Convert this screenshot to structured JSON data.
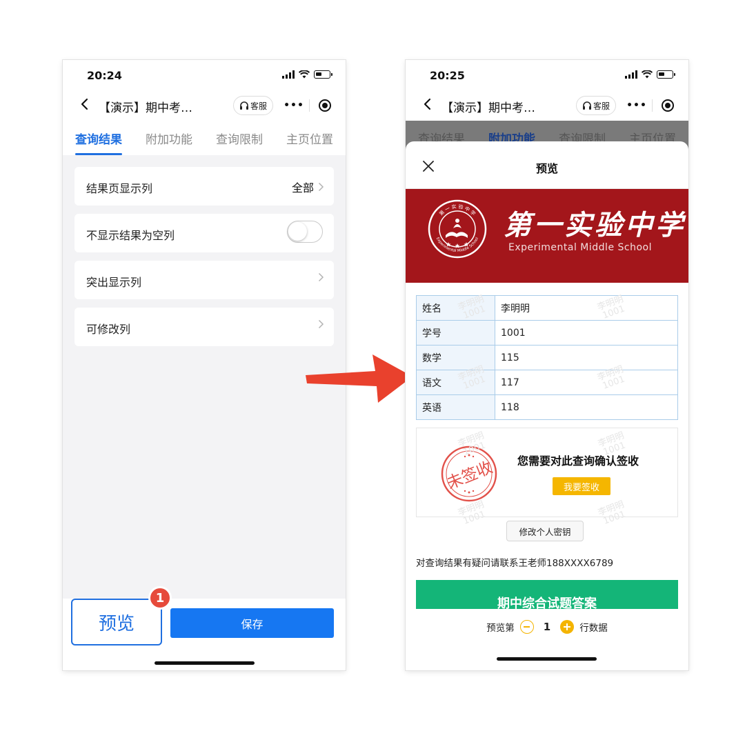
{
  "left_phone": {
    "status": {
      "time": "20:24"
    },
    "nav": {
      "title": "【演示】期中考…",
      "kefu_label": "客服",
      "more_label": "•••"
    },
    "tabs": [
      "查询结果",
      "附加功能",
      "查询限制",
      "主页位置"
    ],
    "settings": [
      {
        "label": "结果页显示列",
        "value": "全部"
      },
      {
        "label": "不显示结果为空列"
      },
      {
        "label": "突出显示列"
      },
      {
        "label": "可修改列"
      }
    ],
    "bottom": {
      "preview_label": "预览",
      "badge": "1",
      "save_label": "保存"
    }
  },
  "right_phone": {
    "status": {
      "time": "20:25"
    },
    "nav": {
      "title": "【演示】期中考…",
      "kefu_label": "客服",
      "more_label": "•••"
    },
    "tabs": [
      "查询结果",
      "附加功能",
      "查询限制",
      "主页位置"
    ],
    "sheet": {
      "title": "预览",
      "school_cn": "第一实验中学",
      "school_en": "Experimental Middle School",
      "seal_top_text": "第 一 实 验 中 学",
      "seal_bottom_text": "Experimental Middle School",
      "rows": [
        {
          "k": "姓名",
          "v": "李明明"
        },
        {
          "k": "学号",
          "v": "1001"
        },
        {
          "k": "数学",
          "v": "115"
        },
        {
          "k": "语文",
          "v": "117"
        },
        {
          "k": "英语",
          "v": "118"
        }
      ],
      "watermark_name": "李明明",
      "watermark_id": "1001",
      "stamp_text": "未签收",
      "sign_title": "您需要对此查询确认签收",
      "sign_button": "我要签收",
      "password_button": "修改个人密钥",
      "contact": "对查询结果有疑问请联系王老师188XXXX6789",
      "answer_button": "期中综合试题答案",
      "pager": {
        "prefix": "预览第",
        "page": "1",
        "suffix": "行数据"
      }
    }
  },
  "colors": {
    "primary": "#1677f2",
    "badge": "#e64a3b",
    "arrow": "#e9412d",
    "banner": "#a3161b",
    "answer": "#14b578",
    "accent": "#f4b400"
  }
}
